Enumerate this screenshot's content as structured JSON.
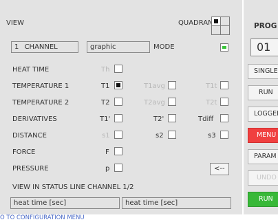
{
  "view": {
    "title": "VIEW",
    "quadrant_label": "QUADRANT",
    "channel_number": "1",
    "channel_label": "CHANNEL",
    "mode_field": "graphic",
    "mode_label": "MODE"
  },
  "rows": [
    {
      "label": "HEAT TIME",
      "c1": "Th"
    },
    {
      "label": "TEMPERATURE 1",
      "c1": "T1",
      "c2": "T1avg",
      "c3": "T1t"
    },
    {
      "label": "TEMPERATURE 2",
      "c1": "T2",
      "c2": "T2avg",
      "c3": "T2t"
    },
    {
      "label": "DERIVATIVES",
      "c1": "T1'",
      "c2": "T2'",
      "c3": "Tdiff"
    },
    {
      "label": "DISTANCE",
      "c1": "s1",
      "c2": "s2",
      "c3": "s3"
    },
    {
      "label": "FORCE",
      "c1": "F"
    },
    {
      "label": "PRESSURE",
      "c1": "p"
    }
  ],
  "back_button": "<--",
  "status_line": {
    "label": "VIEW IN STATUS LINE CHANNEL 1/2",
    "field1": "heat time [sec]",
    "field2": "heat time [sec]"
  },
  "prog": {
    "label": "PROG",
    "value": "01"
  },
  "side_buttons": {
    "single": "SINGLE",
    "run": "RUN",
    "logger": "LOGGER",
    "menu": "MENU",
    "param": "PARAM",
    "undo": "UNDO",
    "run2": "RUN"
  },
  "footer": "O TO CONFIGURATION MENU",
  "colors": {
    "menu_red": "#f04040",
    "run_green": "#38b838",
    "indicator_green": "#3ac43a"
  }
}
